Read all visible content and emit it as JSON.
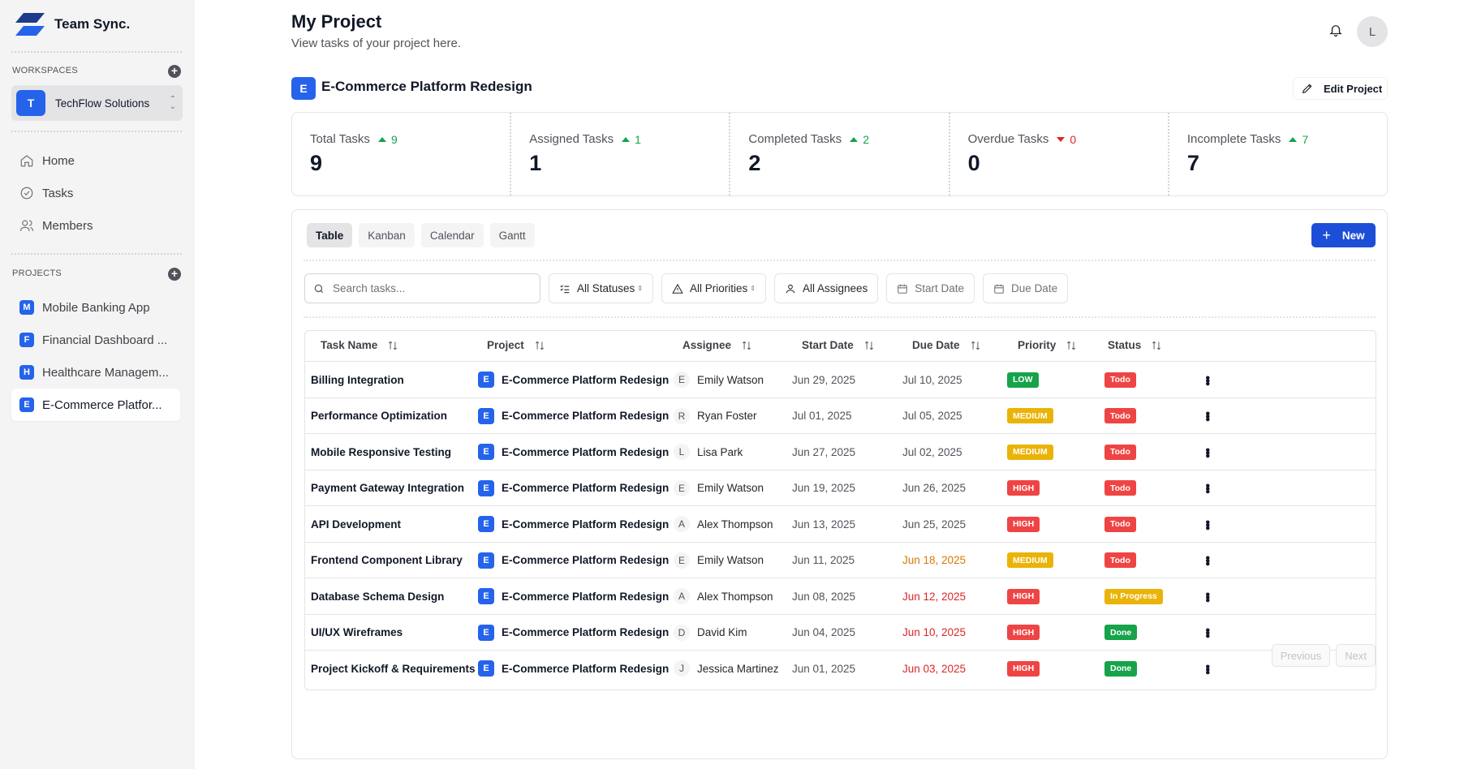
{
  "brand": {
    "name": "Team Sync."
  },
  "sidebar": {
    "workspaces_label": "WORKSPACES",
    "workspace": {
      "initial": "T",
      "name": "TechFlow Solutions"
    },
    "nav": [
      {
        "label": "Home",
        "icon": "home-icon"
      },
      {
        "label": "Tasks",
        "icon": "check-circle-icon"
      },
      {
        "label": "Members",
        "icon": "users-icon"
      }
    ],
    "projects_label": "PROJECTS",
    "projects": [
      {
        "initial": "M",
        "name": "Mobile Banking App"
      },
      {
        "initial": "F",
        "name": "Financial Dashboard ..."
      },
      {
        "initial": "H",
        "name": "Healthcare Managem..."
      },
      {
        "initial": "E",
        "name": "E-Commerce Platfor..."
      }
    ]
  },
  "header": {
    "title": "My Project",
    "subtitle": "View tasks of your project here.",
    "user_initial": "L"
  },
  "project": {
    "initial": "E",
    "name": "E-Commerce Platform Redesign",
    "edit_label": "Edit Project"
  },
  "stats": [
    {
      "label": "Total Tasks",
      "delta": "9",
      "trend": "up",
      "value": "9"
    },
    {
      "label": "Assigned Tasks",
      "delta": "1",
      "trend": "up",
      "value": "1"
    },
    {
      "label": "Completed Tasks",
      "delta": "2",
      "trend": "up",
      "value": "2"
    },
    {
      "label": "Overdue Tasks",
      "delta": "0",
      "trend": "down",
      "value": "0"
    },
    {
      "label": "Incomplete Tasks",
      "delta": "7",
      "trend": "up",
      "value": "7"
    }
  ],
  "views": {
    "tabs": [
      "Table",
      "Kanban",
      "Calendar",
      "Gantt"
    ],
    "active": "Table",
    "new_label": "New"
  },
  "filters": {
    "search_placeholder": "Search tasks...",
    "status": "All Statuses",
    "priority": "All Priorities",
    "assignee": "All Assignees",
    "start_date": "Start Date",
    "due_date": "Due Date"
  },
  "table": {
    "columns": [
      "Task Name",
      "Project",
      "Assignee",
      "Start Date",
      "Due Date",
      "Priority",
      "Status"
    ],
    "rows": [
      {
        "task": "Billing Integration",
        "project": "E-Commerce Platform Redesign",
        "assignee_initial": "E",
        "assignee": "Emily Watson",
        "start": "Jun 29, 2025",
        "due": "Jul 10, 2025",
        "due_state": "normal",
        "priority": "LOW",
        "status": "Todo"
      },
      {
        "task": "Performance Optimization",
        "project": "E-Commerce Platform Redesign",
        "assignee_initial": "R",
        "assignee": "Ryan Foster",
        "start": "Jul 01, 2025",
        "due": "Jul 05, 2025",
        "due_state": "normal",
        "priority": "MEDIUM",
        "status": "Todo"
      },
      {
        "task": "Mobile Responsive Testing",
        "project": "E-Commerce Platform Redesign",
        "assignee_initial": "L",
        "assignee": "Lisa Park",
        "start": "Jun 27, 2025",
        "due": "Jul 02, 2025",
        "due_state": "normal",
        "priority": "MEDIUM",
        "status": "Todo"
      },
      {
        "task": "Payment Gateway Integration",
        "project": "E-Commerce Platform Redesign",
        "assignee_initial": "E",
        "assignee": "Emily Watson",
        "start": "Jun 19, 2025",
        "due": "Jun 26, 2025",
        "due_state": "normal",
        "priority": "HIGH",
        "status": "Todo"
      },
      {
        "task": "API Development",
        "project": "E-Commerce Platform Redesign",
        "assignee_initial": "A",
        "assignee": "Alex Thompson",
        "start": "Jun 13, 2025",
        "due": "Jun 25, 2025",
        "due_state": "normal",
        "priority": "HIGH",
        "status": "Todo"
      },
      {
        "task": "Frontend Component Library",
        "project": "E-Commerce Platform Redesign",
        "assignee_initial": "E",
        "assignee": "Emily Watson",
        "start": "Jun 11, 2025",
        "due": "Jun 18, 2025",
        "due_state": "warn",
        "priority": "MEDIUM",
        "status": "Todo"
      },
      {
        "task": "Database Schema Design",
        "project": "E-Commerce Platform Redesign",
        "assignee_initial": "A",
        "assignee": "Alex Thompson",
        "start": "Jun 08, 2025",
        "due": "Jun 12, 2025",
        "due_state": "late",
        "priority": "HIGH",
        "status": "In Progress"
      },
      {
        "task": "UI/UX Wireframes",
        "project": "E-Commerce Platform Redesign",
        "assignee_initial": "D",
        "assignee": "David Kim",
        "start": "Jun 04, 2025",
        "due": "Jun 10, 2025",
        "due_state": "late",
        "priority": "HIGH",
        "status": "Done"
      },
      {
        "task": "Project Kickoff & Requirements",
        "project": "E-Commerce Platform Redesign",
        "assignee_initial": "J",
        "assignee": "Jessica Martinez",
        "start": "Jun 01, 2025",
        "due": "Jun 03, 2025",
        "due_state": "late",
        "priority": "HIGH",
        "status": "Done"
      }
    ]
  },
  "pagination": {
    "previous": "Previous",
    "next": "Next"
  },
  "colors": {
    "accent": "#2563eb",
    "priority": {
      "LOW": "#16a34a",
      "MEDIUM": "#eab308",
      "HIGH": "#ef4444"
    },
    "status": {
      "Todo": "#ef4444",
      "In Progress": "#eab308",
      "Done": "#16a34a"
    }
  }
}
